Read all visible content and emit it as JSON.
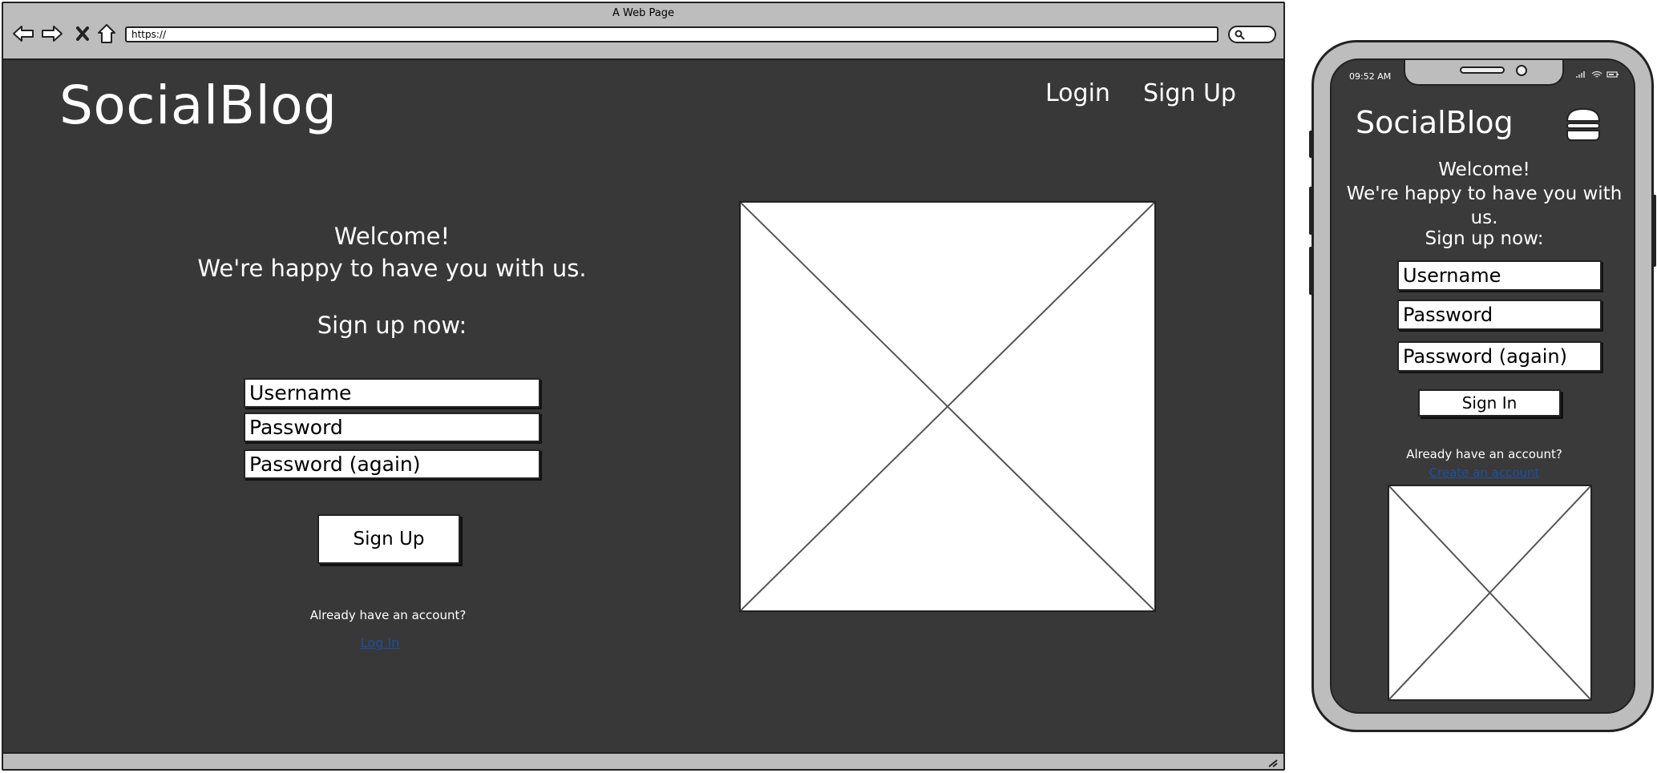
{
  "browser": {
    "title": "A Web Page",
    "url": "https://"
  },
  "desktop": {
    "logo": "SocialBlog",
    "nav": {
      "login": "Login",
      "signup": "Sign Up"
    },
    "welcome_line1": "Welcome!",
    "welcome_line2": "We're happy to have you with us.",
    "signup_now": "Sign up now:",
    "fields": {
      "username": "Username",
      "password": "Password",
      "password_again": "Password (again)"
    },
    "submit_label": "Sign Up",
    "already_text": "Already have an account?",
    "login_link": "Log In"
  },
  "mobile": {
    "time": "09:52 AM",
    "logo": "SocialBlog",
    "welcome_line1": "Welcome!",
    "welcome_line2": "We're happy to have you with us.",
    "signup_now": "Sign up now:",
    "fields": {
      "username": "Username",
      "password": "Password",
      "password_again": "Password (again)"
    },
    "submit_label": "Sign In",
    "already_text": "Already have an account?",
    "create_link": "Create an account"
  },
  "colors": {
    "page_background": "#383838",
    "chrome": "#bdbdbd",
    "link": "#1e4fa0"
  },
  "icons": [
    "back-icon",
    "forward-icon",
    "close-icon",
    "home-icon",
    "search-icon",
    "hamburger-menu-icon",
    "signal-icon",
    "wifi-icon",
    "battery-icon",
    "resize-grip-icon"
  ]
}
